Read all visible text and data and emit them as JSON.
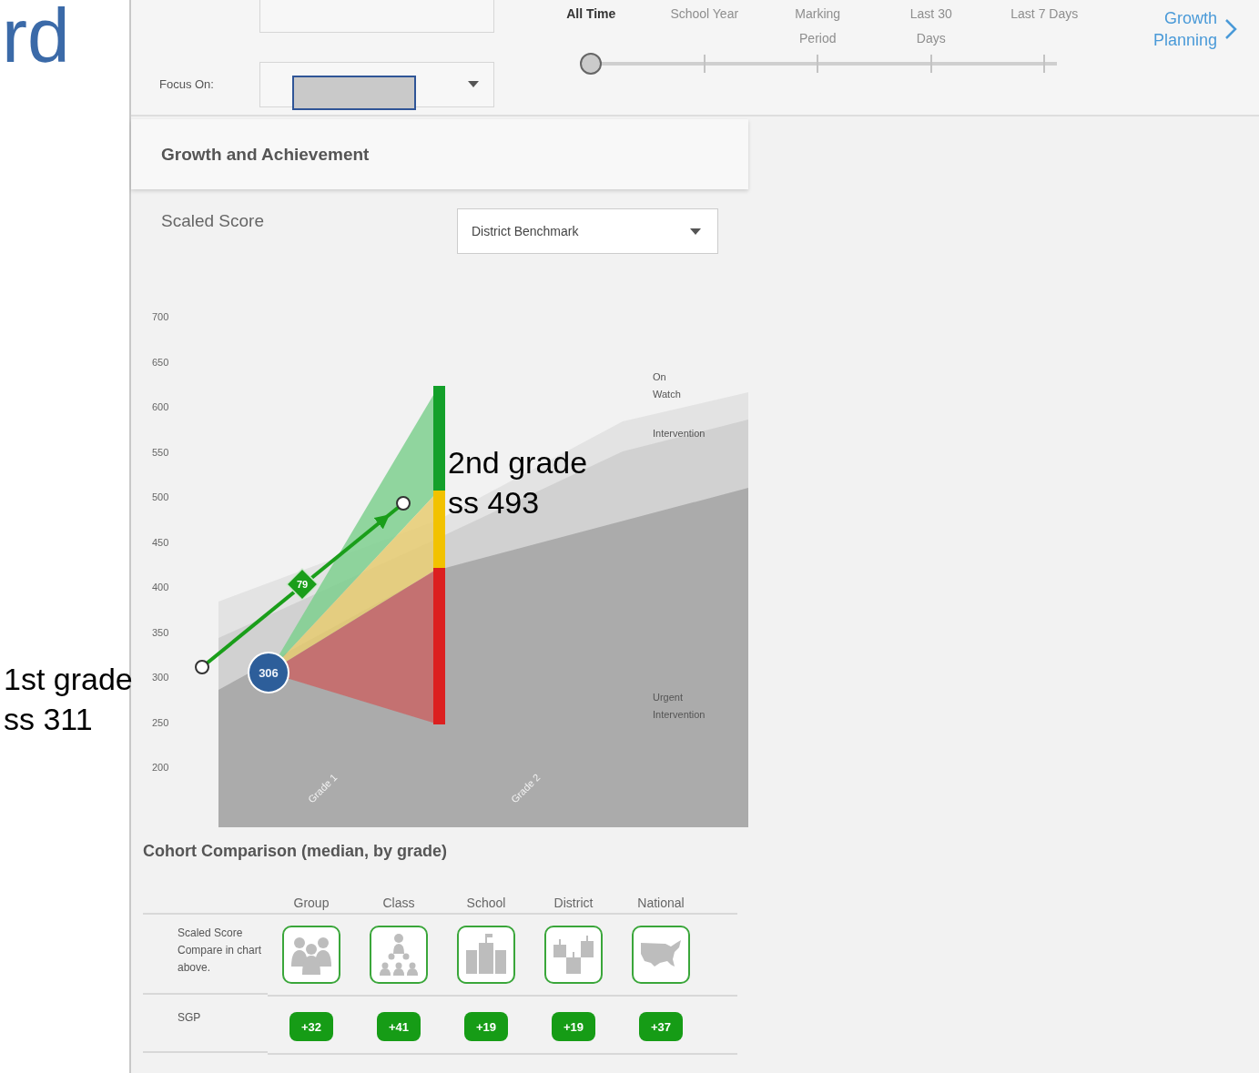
{
  "slide": {
    "title": "rd",
    "annotations": [
      {
        "lines": [
          "1st grade",
          "ss 311"
        ]
      },
      {
        "lines": [
          "2nd grade",
          "ss 493"
        ]
      }
    ]
  },
  "filters": {
    "focus_on": {
      "label": "Focus On:"
    }
  },
  "time_range": {
    "options": [
      {
        "label": "All Time",
        "selected": true
      },
      {
        "label": "School Year",
        "selected": false
      },
      {
        "label": "Marking Period",
        "selected": false
      },
      {
        "label": "Last 30 Days",
        "selected": false
      },
      {
        "label": "Last 7 Days",
        "selected": false
      }
    ]
  },
  "growth_planning_link": "Growth Planning",
  "card": {
    "title": "Growth and Achievement",
    "metric_label": "Scaled Score",
    "benchmark_dropdown": "District Benchmark",
    "chart": {
      "y_axis_labels": [
        "700",
        "650",
        "600",
        "550",
        "500",
        "450",
        "400",
        "350",
        "300",
        "250",
        "200"
      ],
      "x_axis_labels": [
        "Grade 1",
        "Grade 2"
      ],
      "zone_labels": [
        "On Watch",
        "Intervention",
        "Urgent Intervention"
      ],
      "score_marker": "306",
      "growth_marker": "79"
    }
  },
  "cohort": {
    "title": "Cohort Comparison (median, by grade)",
    "columns": [
      "Group",
      "Class",
      "School",
      "District",
      "National"
    ],
    "rows": [
      {
        "kind": "icons",
        "label": "Scaled Score Compare in chart above."
      },
      {
        "kind": "badges",
        "label": "SGP",
        "values": [
          "+32",
          "+41",
          "+19",
          "+19",
          "+37"
        ]
      }
    ]
  }
}
